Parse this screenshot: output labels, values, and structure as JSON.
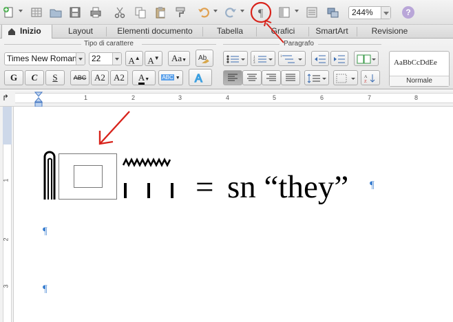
{
  "zoom": "244%",
  "help_label": "?",
  "tabs": [
    {
      "label": "Inizio",
      "active": true
    },
    {
      "label": "Layout"
    },
    {
      "label": "Elementi documento"
    },
    {
      "label": "Tabella"
    },
    {
      "label": "Grafici"
    },
    {
      "label": "SmartArt"
    },
    {
      "label": "Revisione"
    }
  ],
  "ribbon": {
    "font_group_title": "Tipo di carattere",
    "paragraph_group_title": "Paragrafo",
    "font_name": "Times New Roman",
    "font_size": "22",
    "bold_label": "G",
    "italic_label": "C",
    "underline_label": "S",
    "strikethrough_label": "ABC",
    "superscript_label": "A2",
    "subscript_label": "A2",
    "font_color_label": "A",
    "highlight_label": "ABC",
    "grow_font_label": "A",
    "shrink_font_label": "A",
    "change_case_label": "Aa",
    "style_sample": "AaBbCcDdEe",
    "style_name": "Normale"
  },
  "ruler": {
    "tab_selector": "↱",
    "numbers": [
      "1",
      "1",
      "2",
      "3",
      "4",
      "5",
      "6",
      "7",
      "8"
    ],
    "vertical_numbers": [
      "1",
      "2",
      "3"
    ]
  },
  "document": {
    "equals": "=",
    "text": "sn “they”",
    "pilcrow": "¶"
  },
  "colors": {
    "accent_blue": "#3b7fd0",
    "annotation_red": "#d8231b"
  }
}
